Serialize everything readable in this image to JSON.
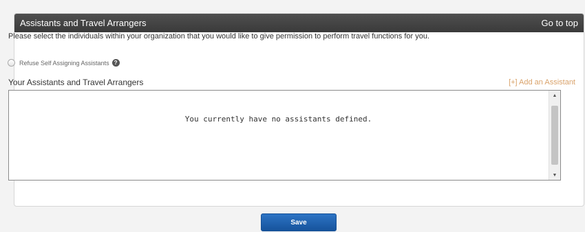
{
  "header": {
    "title": "Assistants and Travel Arrangers",
    "go_to_top": "Go to top"
  },
  "description": "Please select the individuals within your organization that you would like to give permission to perform travel functions for you.",
  "refuse_option": {
    "label": "Refuse Self Assigning Assistants",
    "checked": false,
    "help_icon": "?"
  },
  "assistants_section": {
    "title": "Your Assistants and Travel Arrangers",
    "add_link": "[+] Add an Assistant",
    "empty_message": "You currently have no assistants defined."
  },
  "scrollbar": {
    "up_arrow": "▲",
    "down_arrow": "▼"
  },
  "actions": {
    "save_label": "Save"
  },
  "colors": {
    "header_bg": "#3f3f3f",
    "add_link": "#d9a26a",
    "save_button": "#1f5fad"
  }
}
